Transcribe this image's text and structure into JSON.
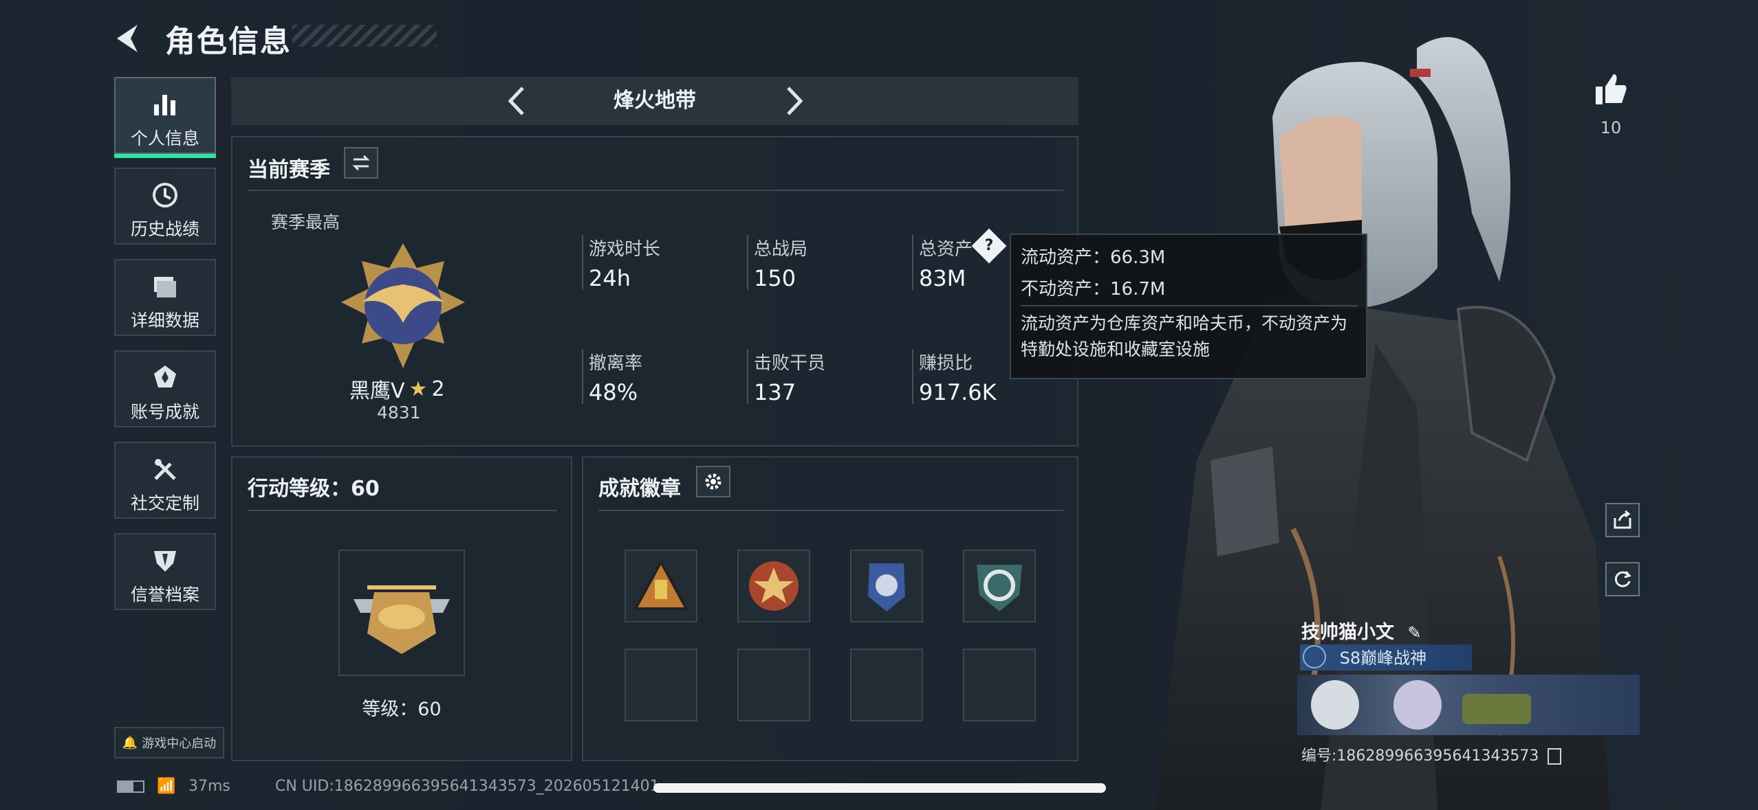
{
  "header": {
    "title": "角色信息"
  },
  "sidebar": {
    "items": [
      {
        "label": "个人信息",
        "icon": "bar-chart-icon",
        "active": true
      },
      {
        "label": "历史战绩",
        "icon": "clock-icon"
      },
      {
        "label": "详细数据",
        "icon": "folder-icon"
      },
      {
        "label": "账号成就",
        "icon": "medal-icon"
      },
      {
        "label": "社交定制",
        "icon": "tools-icon"
      },
      {
        "label": "信誉档案",
        "icon": "shield-icon"
      }
    ],
    "footer_button": "游戏中心启动"
  },
  "season_bar": {
    "name": "烽火地带"
  },
  "current_season": {
    "title": "当前赛季",
    "best_label": "赛季最高",
    "rank_name": "黑鹰V",
    "rank_stars": "2",
    "rank_score": "4831",
    "stats": [
      {
        "label": "游戏时长",
        "value": "24h"
      },
      {
        "label": "总战局",
        "value": "150"
      },
      {
        "label": "总资产",
        "value": "83M"
      },
      {
        "label": "撤离率",
        "value": "48%"
      },
      {
        "label": "击败干员",
        "value": "137"
      },
      {
        "label": "赚损比",
        "value": "917.6K"
      }
    ]
  },
  "tooltip": {
    "liquid": "流动资产：66.3M",
    "fixed": "不动资产：16.7M",
    "desc": "流动资产为仓库资产和哈夫币，不动资产为特勤处设施和收藏室设施"
  },
  "action_level": {
    "title": "行动等级：60",
    "level_text": "等级：60"
  },
  "achievements": {
    "title": "成就徽章",
    "badge_count_filled": 4,
    "slots": 8
  },
  "player": {
    "likes": "10",
    "name": "技帅猫小文",
    "rank_tag": "S8巅峰战神",
    "uid_label": "编号:1862899663956413435​73"
  },
  "status_bar": {
    "ping": "37ms",
    "uid": "CN UID:1862899663956413435​73_202605121401"
  },
  "colors": {
    "accent": "#2ee6a0",
    "background": "#1b242d",
    "panel": "#1f2a33"
  }
}
